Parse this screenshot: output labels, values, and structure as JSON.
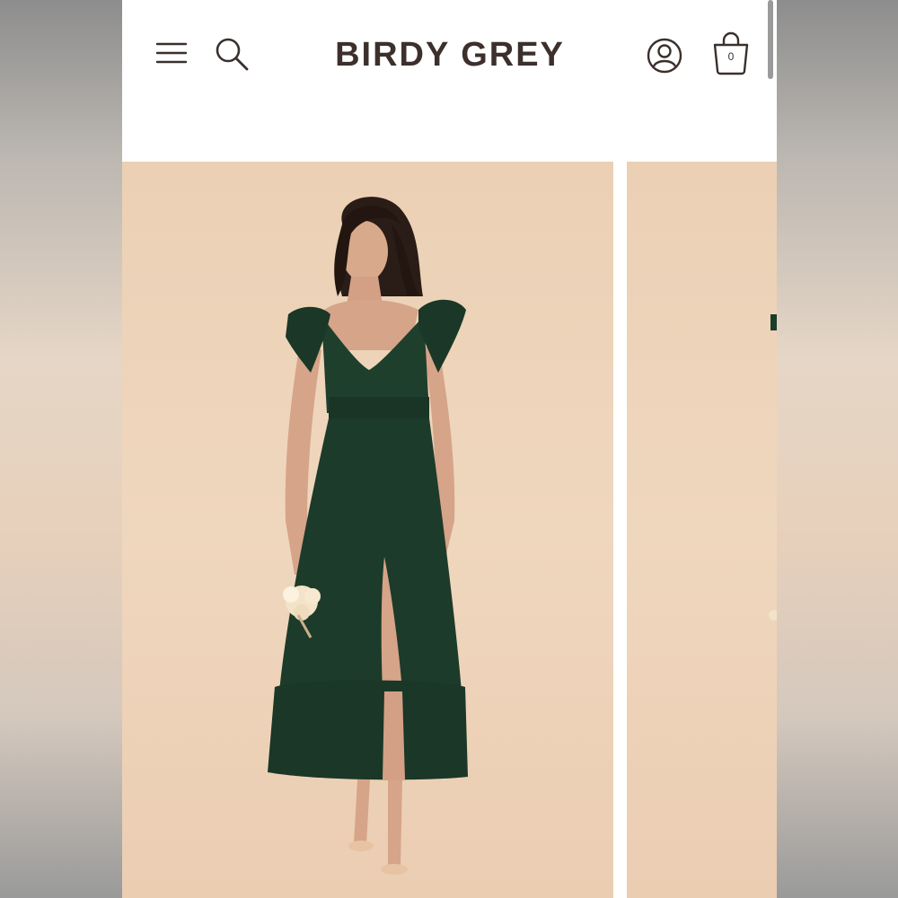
{
  "header": {
    "logo_text": "BIRDY GREY",
    "bag_count": "0"
  },
  "icons": {
    "menu": "hamburger-menu-icon",
    "search": "search-icon",
    "account": "account-icon",
    "bag": "shopping-bag-icon"
  },
  "gallery": {
    "slides": [
      {
        "subject": "model-in-green-dress"
      },
      {
        "subject": "partial-next-image"
      }
    ]
  },
  "colors": {
    "logo": "#3d302c",
    "background": "#ecd1b6",
    "dress": "#1d3a2a"
  }
}
